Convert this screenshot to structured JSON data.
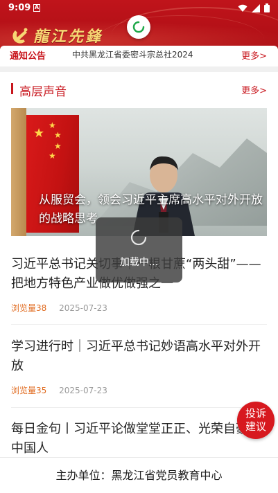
{
  "status_bar": {
    "time": "9:09",
    "notif_icon": "a-letter-icon",
    "icons": [
      "wifi-icon",
      "signal-icon",
      "battery-icon"
    ]
  },
  "header": {
    "brand": "龍江先鋒",
    "emblem_icon": "party-emblem-icon",
    "accent": "#c8161d",
    "gold": "#f7d774"
  },
  "notice": {
    "label": "通知公告",
    "text": "中共黑龙江省委密斗宗总社2024",
    "more": "更多>"
  },
  "section": {
    "title": "高层声音",
    "more": "更多>"
  },
  "banner": {
    "caption": "从服贸会，领会习近平主席高水平对外开放的战略思考"
  },
  "articles": [
    {
      "title": "习近平总书记关切事｜一根甘蔗“两头甜”——把地方特色产业做优做强之一",
      "views": "浏览量38",
      "date": "2025-07-23"
    },
    {
      "title": "学习进行时｜习近平总书记妙语高水平对外开放",
      "views": "浏览量35",
      "date": "2025-07-23"
    },
    {
      "title": "每日金句丨习近平论做堂堂正正、光荣自豪的中国人",
      "views": "",
      "date": ""
    }
  ],
  "loading": {
    "label": "加载中..."
  },
  "complain_button": {
    "line1": "投诉",
    "line2": "建议"
  },
  "footer": {
    "text": "主办单位：黑龙江省党员教育中心"
  }
}
